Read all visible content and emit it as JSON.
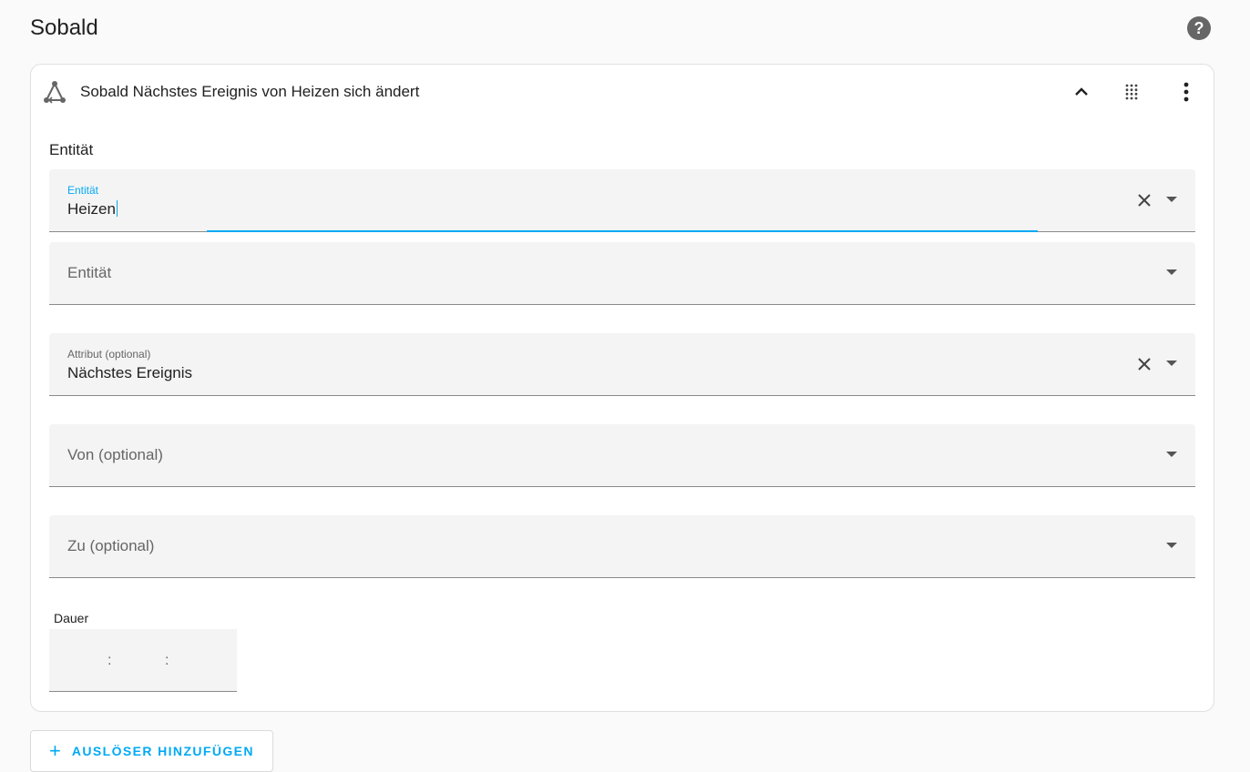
{
  "page": {
    "title": "Sobald",
    "help_icon": "help-circle-icon"
  },
  "trigger": {
    "title": "Sobald Nächstes Ereignis von Heizen sich ändert",
    "icon": "state-trigger-icon",
    "collapse_icon": "chevron-up-icon",
    "drag_icon": "drag-handle-icon",
    "menu_icon": "dots-vertical-icon"
  },
  "form": {
    "section_label": "Entität",
    "entity_field": {
      "label": "Entität",
      "value": "Heizen"
    },
    "entity_add_field": {
      "placeholder": "Entität"
    },
    "attribute_field": {
      "label": "Attribut (optional)",
      "value": "Nächstes Ereignis"
    },
    "from_field": {
      "placeholder": "Von (optional)"
    },
    "to_field": {
      "placeholder": "Zu (optional)"
    },
    "duration": {
      "label": "Dauer",
      "separator": ":"
    }
  },
  "actions": {
    "add_trigger_label": "AUSLÖSER HINZUFÜGEN",
    "add_icon": "plus-icon"
  },
  "colors": {
    "accent": "#03a9f4",
    "field_bg": "#f4f4f4",
    "text_primary": "#212121",
    "text_secondary": "#666666"
  }
}
